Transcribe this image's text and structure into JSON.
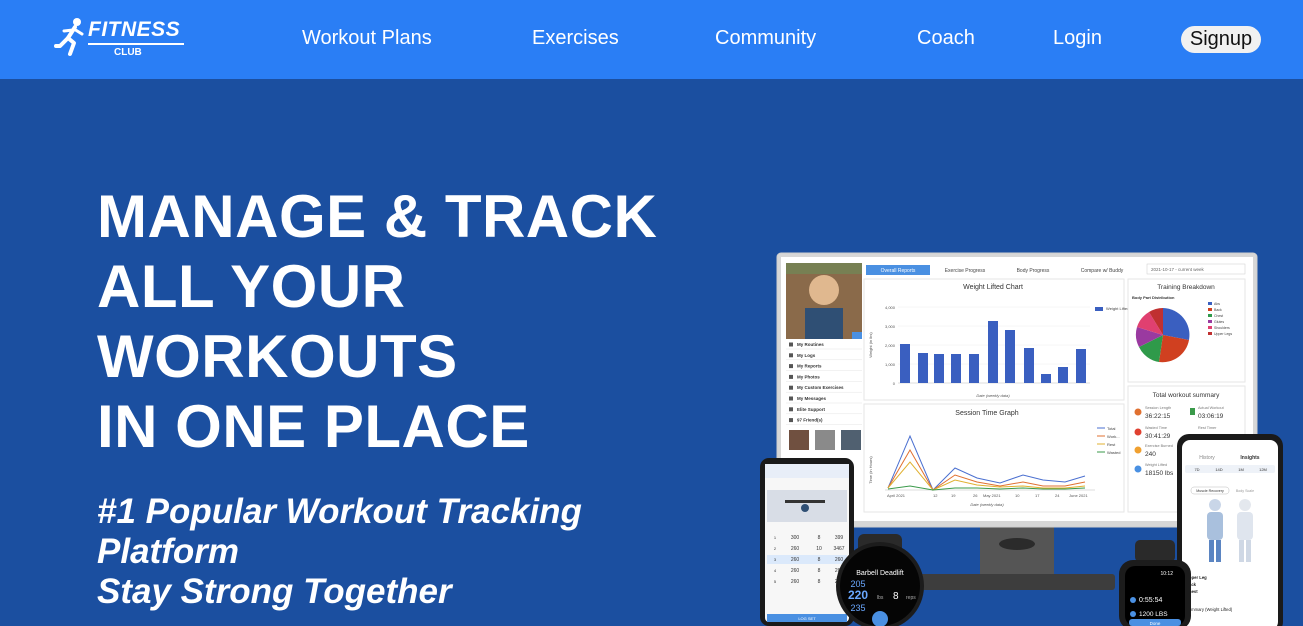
{
  "header": {
    "logo_word": "FITNESS",
    "logo_sub": "CLUB",
    "nav": {
      "workout_plans": "Workout Plans",
      "exercises": "Exercises",
      "community": "Community",
      "coach": "Coach",
      "login": "Login",
      "signup": "Signup"
    }
  },
  "hero": {
    "title_line1": "MANAGE & TRACK",
    "title_line2": "ALL YOUR",
    "title_line3": "WORKOUTS",
    "title_line4": "IN ONE PLACE",
    "tagline_line1": "#1 Popular Workout Tracking",
    "tagline_line2": "Platform",
    "tagline_line3": "Stay Strong Together"
  },
  "mockup": {
    "tabs": [
      "Overall Reports",
      "Exercise Progress",
      "Body Progress",
      "Compare w/ Buddy"
    ],
    "date_select": "2021-10-17 - current week",
    "sidebar_items": [
      "My Routines",
      "My Logs",
      "My Reports",
      "My Photos",
      "My Custom Exercises",
      "My Messages",
      "Elite Support",
      "97 Friend(s)"
    ],
    "weight_chart": {
      "title": "Weight Lifted Chart",
      "ylabel": "Weight (in lbs)",
      "xlabel": "Date (weekly data)",
      "legend": "Weight Lifted",
      "y_ticks": [
        "4,000",
        "3,000",
        "2,000",
        "1,000",
        "0"
      ]
    },
    "session_chart": {
      "title": "Session Time Graph",
      "ylabel": "Time (in Hours)",
      "xlabel": "Date (weekly data)",
      "legend": [
        "Total",
        "Work...",
        "Rest",
        "Wasted"
      ],
      "x_ticks": [
        "April 2021",
        "12",
        "19",
        "26",
        "May 2021",
        "10",
        "17",
        "24",
        "June 2021"
      ]
    },
    "training_breakdown": {
      "title": "Training Breakdown",
      "subtitle": "Body Part Distribution",
      "legend": [
        "Abs",
        "Back",
        "Chest",
        "Glutes",
        "Shoulders",
        "Upper Legs"
      ]
    },
    "summary": {
      "title": "Total workout summary",
      "session_length_label": "Session Length",
      "session_length": "36:22:15",
      "actual_workout_label": "Actual Workout",
      "actual_workout": "03:06:19",
      "wasted_label": "Wasted Time",
      "wasted": "30:41:29",
      "rest_label": "Rest Timer",
      "burned_label": "Exercise Burned",
      "burned": "240",
      "weight_label": "Weight Lifted",
      "weight": "18150 lbs"
    },
    "phone_left": {
      "log_set": "LOG SET",
      "rows": [
        [
          "1",
          "300",
          "8",
          "399"
        ],
        [
          "2",
          "260",
          "10",
          "3467"
        ],
        [
          "3",
          "260",
          "8",
          "260"
        ],
        [
          "4",
          "260",
          "8",
          "260"
        ],
        [
          "5",
          "260",
          "8",
          "260"
        ]
      ]
    },
    "watch_left": {
      "exercise": "Barbell Deadlift",
      "values": [
        "205",
        "220",
        "235"
      ],
      "unit": "lbs",
      "reps": "8",
      "reps_unit": "reps"
    },
    "phone_right": {
      "tabs": [
        "History",
        "Insights"
      ],
      "ranges": [
        "7D",
        "14D",
        "1M",
        "12M"
      ],
      "toggles": [
        "Muscle Recovery",
        "Body Scale"
      ],
      "rows": [
        "Upper Leg",
        "Back",
        "Chest"
      ],
      "summary": "Summary (Weight Lifted)"
    },
    "watch_right": {
      "time": "10:12",
      "duration": "0:55:54",
      "weight": "1200 LBS",
      "done": "Done"
    }
  },
  "colors": {
    "nav_bg": "#2a7ef5",
    "hero_bg": "#1b4fa0",
    "bar_blue": "#3a5fc0"
  }
}
